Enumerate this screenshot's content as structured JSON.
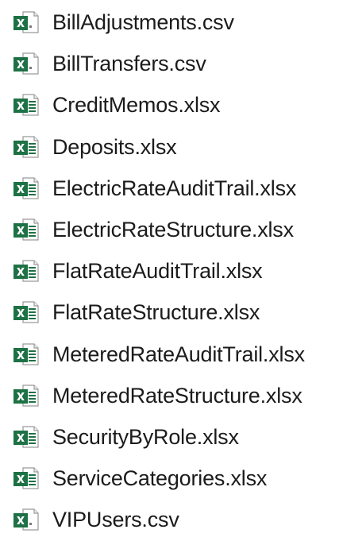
{
  "file_list": {
    "items": [
      {
        "name": "BillAdjustments.csv",
        "type": "csv",
        "icon": "excel-csv-file-icon"
      },
      {
        "name": "BillTransfers.csv",
        "type": "csv",
        "icon": "excel-csv-file-icon"
      },
      {
        "name": "CreditMemos.xlsx",
        "type": "xlsx",
        "icon": "excel-xlsx-file-icon"
      },
      {
        "name": "Deposits.xlsx",
        "type": "xlsx",
        "icon": "excel-xlsx-file-icon"
      },
      {
        "name": "ElectricRateAuditTrail.xlsx",
        "type": "xlsx",
        "icon": "excel-xlsx-file-icon"
      },
      {
        "name": "ElectricRateStructure.xlsx",
        "type": "xlsx",
        "icon": "excel-xlsx-file-icon"
      },
      {
        "name": "FlatRateAuditTrail.xlsx",
        "type": "xlsx",
        "icon": "excel-xlsx-file-icon"
      },
      {
        "name": "FlatRateStructure.xlsx",
        "type": "xlsx",
        "icon": "excel-xlsx-file-icon"
      },
      {
        "name": "MeteredRateAuditTrail.xlsx",
        "type": "xlsx",
        "icon": "excel-xlsx-file-icon"
      },
      {
        "name": "MeteredRateStructure.xlsx",
        "type": "xlsx",
        "icon": "excel-xlsx-file-icon"
      },
      {
        "name": "SecurityByRole.xlsx",
        "type": "xlsx",
        "icon": "excel-xlsx-file-icon"
      },
      {
        "name": "ServiceCategories.xlsx",
        "type": "xlsx",
        "icon": "excel-xlsx-file-icon"
      },
      {
        "name": "VIPUsers.csv",
        "type": "csv",
        "icon": "excel-csv-file-icon"
      }
    ]
  },
  "colors": {
    "excel_green": "#1e7145",
    "excel_green_light": "#21a366",
    "text": "#1b1b1b"
  }
}
